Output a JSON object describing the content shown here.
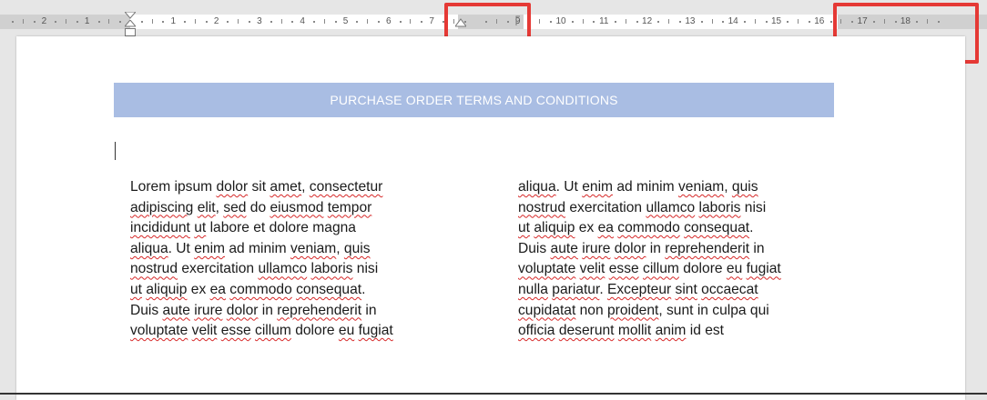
{
  "ruler": {
    "left_numbers": [
      "2",
      "1"
    ],
    "right_numbers": [
      "1",
      "2",
      "3",
      "4",
      "5",
      "6",
      "7",
      "9",
      "10",
      "11",
      "12",
      "13",
      "14",
      "15",
      "16",
      "17",
      "18"
    ]
  },
  "document": {
    "title": "PURCHASE ORDER TERMS AND CONDITIONS",
    "column_left": [
      [
        "Lorem ipsum ",
        {
          "w": "dolor"
        },
        " sit ",
        {
          "w": "amet"
        },
        ", ",
        {
          "w": "consectetur"
        }
      ],
      [
        {
          "w": "adipiscing"
        },
        " ",
        {
          "w": "elit"
        },
        ", ",
        {
          "w": "sed"
        },
        " do ",
        {
          "w": "eiusmod"
        },
        " ",
        {
          "w": "tempor"
        }
      ],
      [
        {
          "w": "incididunt"
        },
        " ",
        {
          "w": "ut"
        },
        " labore et dolore magna"
      ],
      [
        {
          "w": "aliqua"
        },
        ". Ut ",
        {
          "w": "enim"
        },
        " ad minim ",
        {
          "w": "veniam"
        },
        ", ",
        {
          "w": "quis"
        }
      ],
      [
        {
          "w": "nostrud"
        },
        " exercitation ",
        {
          "w": "ullamco"
        },
        " ",
        {
          "w": "laboris"
        },
        " nisi"
      ],
      [
        {
          "w": "ut"
        },
        " ",
        {
          "w": "aliquip"
        },
        " ex ",
        {
          "w": "ea"
        },
        " ",
        {
          "w": "commodo"
        },
        " ",
        {
          "w": "consequat"
        },
        "."
      ],
      [
        "Duis ",
        {
          "w": "aute"
        },
        " ",
        {
          "w": "irure"
        },
        " ",
        {
          "w": "dolor"
        },
        " in ",
        {
          "w": "reprehenderit"
        },
        " in"
      ],
      [
        {
          "w": "voluptate"
        },
        " ",
        {
          "w": "velit"
        },
        " ",
        {
          "w": "esse"
        },
        " ",
        {
          "w": "cillum"
        },
        " dolore ",
        {
          "w": "eu"
        },
        " ",
        {
          "w": "fugiat"
        }
      ]
    ],
    "column_right": [
      [
        {
          "w": "aliqua"
        },
        ". Ut ",
        {
          "w": "enim"
        },
        " ad minim ",
        {
          "w": "veniam"
        },
        ", ",
        {
          "w": "quis"
        }
      ],
      [
        {
          "w": "nostrud"
        },
        " exercitation ",
        {
          "w": "ullamco"
        },
        " ",
        {
          "w": "laboris"
        },
        " nisi"
      ],
      [
        {
          "w": "ut"
        },
        " ",
        {
          "w": "aliquip"
        },
        " ex ",
        {
          "w": "ea"
        },
        " ",
        {
          "w": "commodo"
        },
        " ",
        {
          "w": "consequat"
        },
        "."
      ],
      [
        "Duis ",
        {
          "w": "aute"
        },
        " ",
        {
          "w": "irure"
        },
        " ",
        {
          "w": "dolor"
        },
        " in ",
        {
          "w": "reprehenderit"
        },
        " in"
      ],
      [
        {
          "w": "voluptate"
        },
        " ",
        {
          "w": "velit"
        },
        " ",
        {
          "w": "esse"
        },
        " ",
        {
          "w": "cillum"
        },
        " dolore ",
        {
          "w": "eu"
        },
        " ",
        {
          "w": "fugiat"
        }
      ],
      [
        {
          "w": "nulla"
        },
        " ",
        {
          "w": "pariatur"
        },
        ". ",
        {
          "w": "Excepteur"
        },
        " ",
        {
          "w": "sint"
        },
        " ",
        {
          "w": "occaecat"
        }
      ],
      [
        {
          "w": "cupidatat"
        },
        " non ",
        {
          "w": "proident"
        },
        ", sunt in culpa qui"
      ],
      [
        {
          "w": "officia"
        },
        " ",
        {
          "w": "deserunt"
        },
        " ",
        {
          "w": "mollit"
        },
        " ",
        {
          "w": "anim"
        },
        " id est"
      ]
    ]
  },
  "colors": {
    "title_bar": "#a9bde3",
    "highlight": "#e53935",
    "spellcheck": "#d62828"
  }
}
